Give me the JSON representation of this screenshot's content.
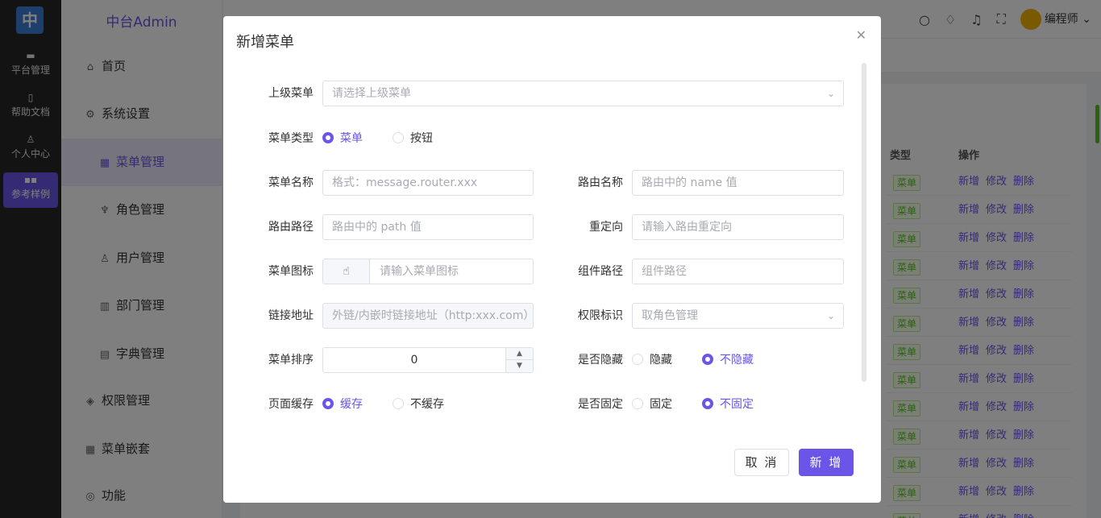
{
  "rail": {
    "logo": "中",
    "items": [
      {
        "label": "平台管理",
        "icon": "monitor-icon"
      },
      {
        "label": "帮助文档",
        "icon": "document-icon"
      },
      {
        "label": "个人中心",
        "icon": "user-icon"
      },
      {
        "label": "参考样例",
        "icon": "grid-icon"
      }
    ]
  },
  "sidebar": {
    "brand": "中台Admin",
    "items": [
      {
        "label": "首页",
        "icon": "home-icon"
      },
      {
        "label": "系统设置",
        "icon": "gear-icon"
      },
      {
        "label": "菜单管理",
        "icon": "grid-icon"
      },
      {
        "label": "角色管理",
        "icon": "role-icon"
      },
      {
        "label": "用户管理",
        "icon": "user-icon"
      },
      {
        "label": "部门管理",
        "icon": "building-icon"
      },
      {
        "label": "字典管理",
        "icon": "dictionary-icon"
      },
      {
        "label": "权限管理",
        "icon": "shield-icon"
      },
      {
        "label": "菜单嵌套",
        "icon": "grid-icon"
      },
      {
        "label": "功能",
        "icon": "feature-icon"
      }
    ]
  },
  "header": {
    "username": "编程师"
  },
  "bg_table": {
    "col_type": "类型",
    "col_ops": "操作",
    "tag": "菜单",
    "op_add": "新增",
    "op_edit": "修改",
    "op_delete": "删除"
  },
  "modal": {
    "title": "新增菜单",
    "parent_label": "上级菜单",
    "parent_placeholder": "请选择上级菜单",
    "type_label": "菜单类型",
    "type_menu": "菜单",
    "type_button": "按钮",
    "name_label": "菜单名称",
    "name_placeholder": "格式：message.router.xxx",
    "route_name_label": "路由名称",
    "route_name_placeholder": "路由中的 name 值",
    "route_path_label": "路由路径",
    "route_path_placeholder": "路由中的 path 值",
    "redirect_label": "重定向",
    "redirect_placeholder": "请输入路由重定向",
    "icon_label": "菜单图标",
    "icon_placeholder": "请输入菜单图标",
    "component_label": "组件路径",
    "component_placeholder": "组件路径",
    "link_label": "链接地址",
    "link_placeholder": "外链/内嵌时链接地址（http:xxx.com）",
    "perm_label": "权限标识",
    "perm_placeholder": "取角色管理",
    "sort_label": "菜单排序",
    "sort_value": "0",
    "hidden_label": "是否隐藏",
    "hidden_yes": "隐藏",
    "hidden_no": "不隐藏",
    "cache_label": "页面缓存",
    "cache_yes": "缓存",
    "cache_no": "不缓存",
    "affix_label": "是否固定",
    "affix_yes": "固定",
    "affix_no": "不固定",
    "cancel": "取 消",
    "submit": "新 增"
  },
  "colors": {
    "accent": "#6a55e8",
    "tag_green": "#52c41a"
  }
}
